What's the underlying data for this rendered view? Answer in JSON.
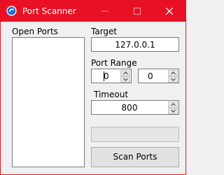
{
  "window": {
    "title": "Port Scanner",
    "accent_color": "#e81123",
    "icon": "app-logo-icon"
  },
  "ports": {
    "label": "Open Ports",
    "items": []
  },
  "target": {
    "label": "Target",
    "value": "127.0.0.1"
  },
  "port_range": {
    "label": "Port Range",
    "start_value": "0",
    "end_value": "0"
  },
  "timeout": {
    "label": "Timeout",
    "value": "800"
  },
  "actions": {
    "scan_label": "Scan Ports"
  }
}
